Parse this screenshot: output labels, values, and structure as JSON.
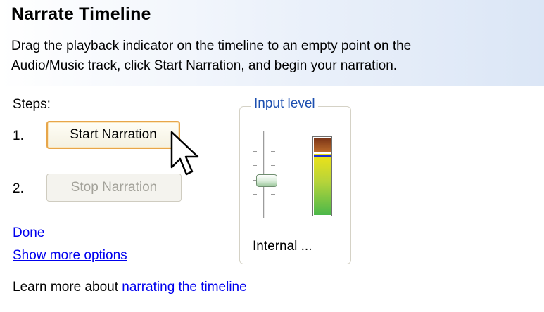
{
  "header": {
    "title": "Narrate Timeline",
    "description_line1": "Drag the playback indicator on the timeline to an empty point on the",
    "description_line2": "Audio/Music track, click Start Narration, and begin your narration."
  },
  "steps": {
    "label": "Steps:",
    "items": [
      {
        "number": "1.",
        "button_label": "Start Narration",
        "enabled": true
      },
      {
        "number": "2.",
        "button_label": "Stop Narration",
        "enabled": false
      }
    ]
  },
  "links": {
    "done": "Done",
    "show_more": "Show more options"
  },
  "input_level": {
    "legend": "Input level",
    "device_label": "Internal ...",
    "meter_level_fraction": 0.78,
    "slider_level_fraction": 0.5
  },
  "footer": {
    "prefix": "Learn more about ",
    "link": "narrating the timeline"
  },
  "colors": {
    "link": "#0000ee",
    "legend": "#1c4fb0",
    "focus_border": "#e7a64a"
  },
  "icons": [
    "mouse-pointer-icon"
  ]
}
